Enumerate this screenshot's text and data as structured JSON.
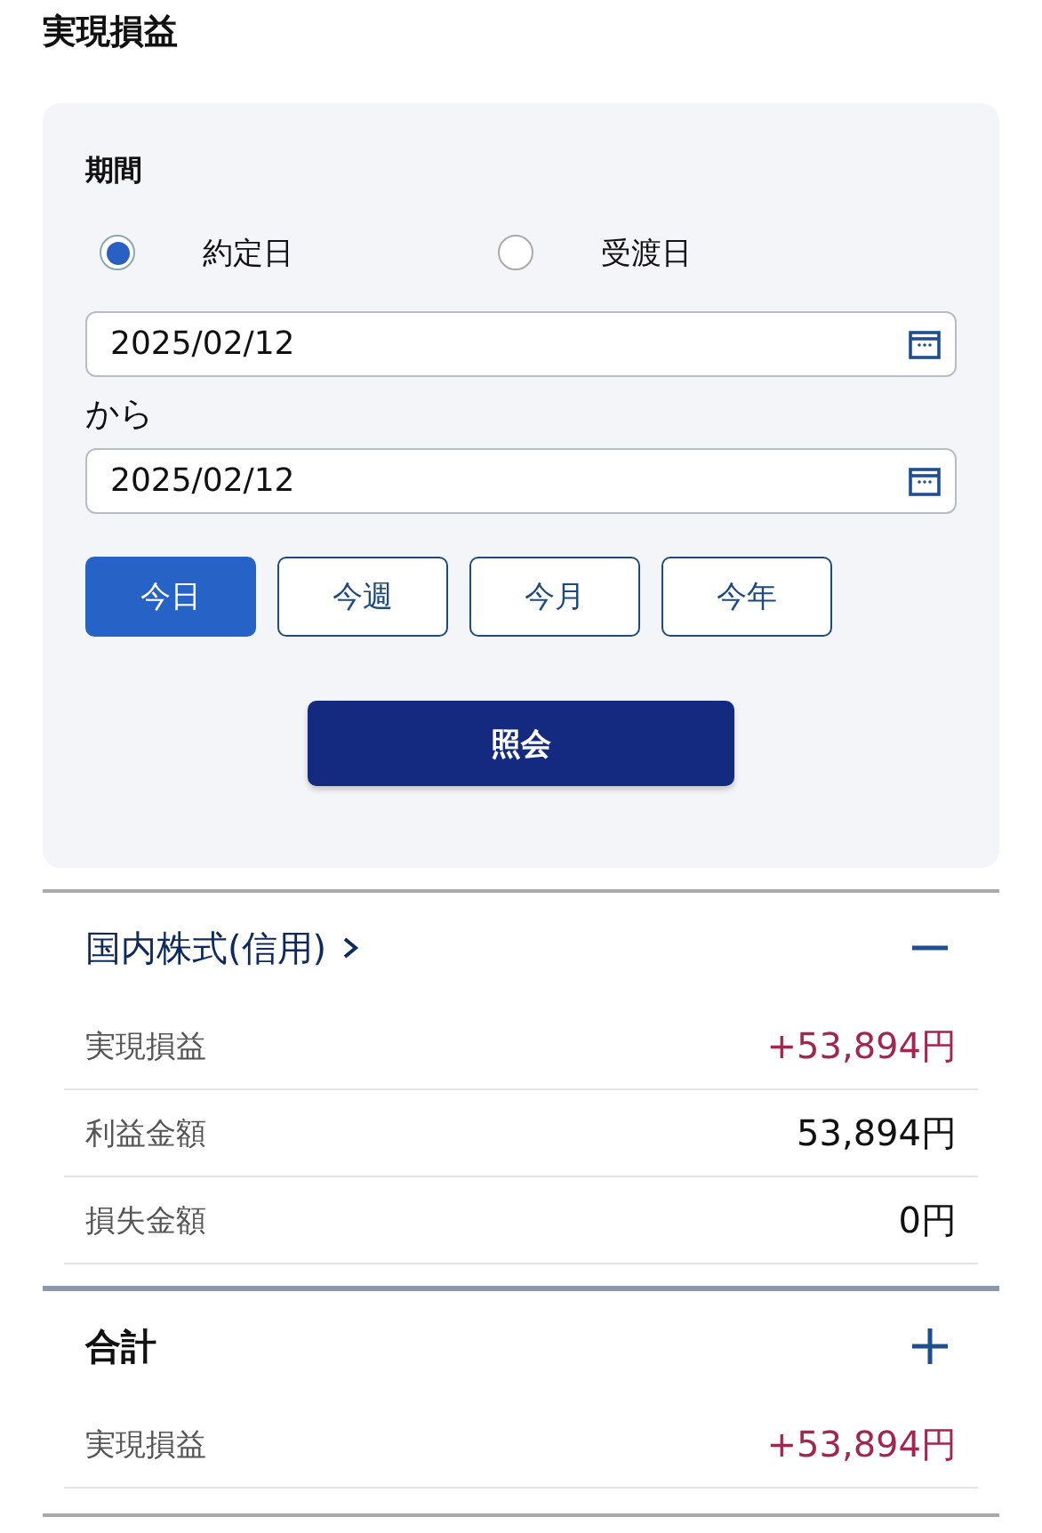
{
  "title": "実現損益",
  "filter": {
    "label": "期間",
    "date_basis": [
      {
        "label": "約定日",
        "selected": true
      },
      {
        "label": "受渡日",
        "selected": false
      }
    ],
    "from_date": "2025/02/12",
    "between": "から",
    "to_date": "2025/02/12",
    "presets": [
      {
        "label": "今日",
        "selected": true
      },
      {
        "label": "今週",
        "selected": false
      },
      {
        "label": "今月",
        "selected": false
      },
      {
        "label": "今年",
        "selected": false
      }
    ],
    "submit": "照会"
  },
  "sections": [
    {
      "title": "国内株式(信用)",
      "link": true,
      "expanded": true,
      "rows": [
        {
          "label": "実現損益",
          "value": "+53,894円",
          "kind": "gain"
        },
        {
          "label": "利益金額",
          "value": "53,894円",
          "kind": "plain"
        },
        {
          "label": "損失金額",
          "value": "0円",
          "kind": "plain"
        }
      ]
    },
    {
      "title": "合計",
      "link": false,
      "expanded": false,
      "rows": [
        {
          "label": "実現損益",
          "value": "+53,894円",
          "kind": "gain"
        }
      ]
    }
  ]
}
